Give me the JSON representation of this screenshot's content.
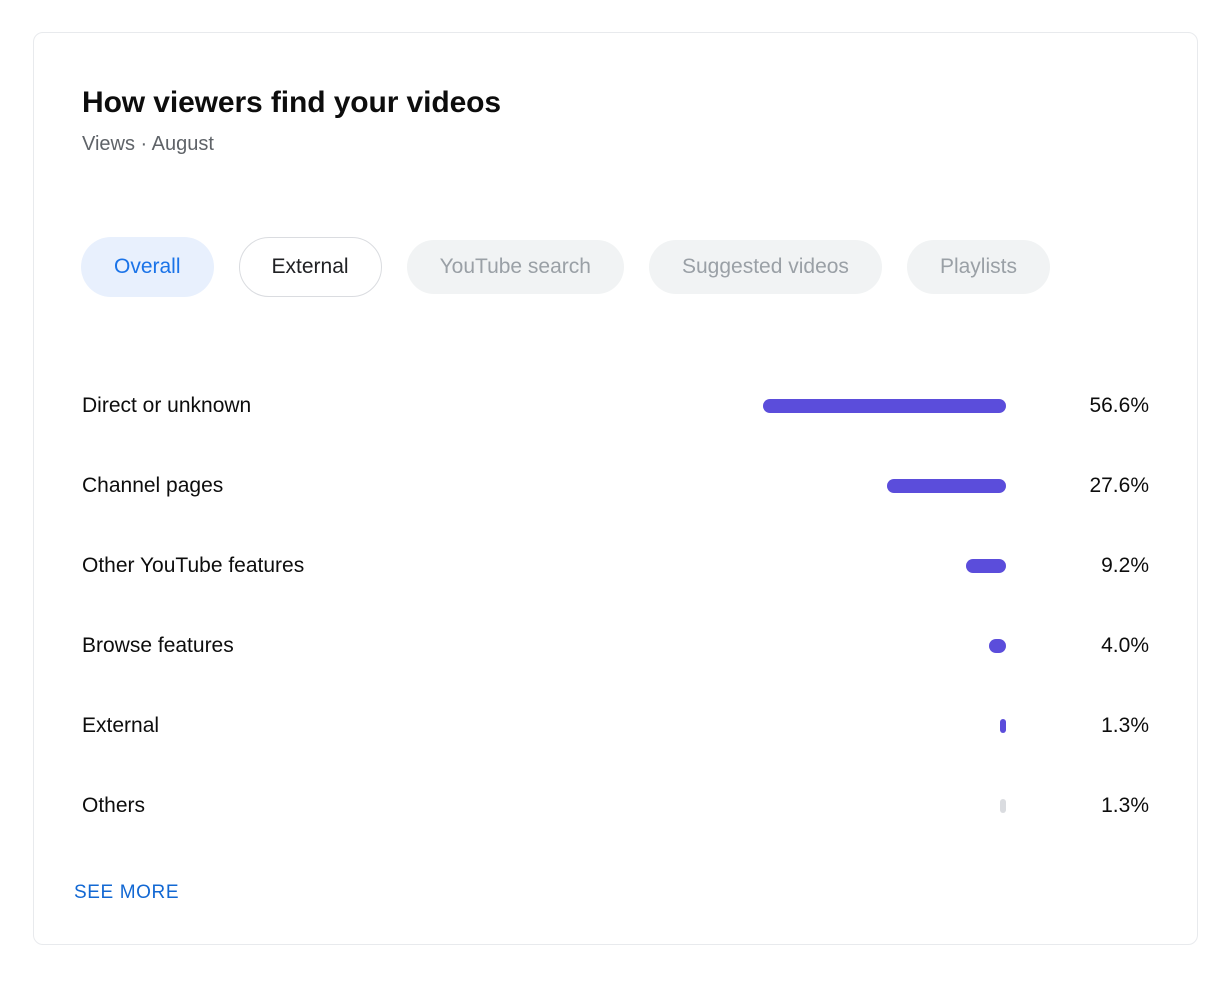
{
  "card": {
    "title": "How viewers find your videos",
    "subtitle": "Views · August",
    "see_more_label": "SEE MORE"
  },
  "chips": [
    {
      "label": "Overall",
      "state": "selected"
    },
    {
      "label": "External",
      "state": "outlined"
    },
    {
      "label": "YouTube search",
      "state": "muted"
    },
    {
      "label": "Suggested videos",
      "state": "muted"
    },
    {
      "label": "Playlists",
      "state": "muted"
    }
  ],
  "colors": {
    "bar_primary": "#5b4ddb",
    "bar_muted": "#dadce0",
    "accent_blue": "#1a73e8",
    "link_blue": "#1268d3",
    "chip_selected_bg": "#e8f0fd",
    "chip_muted_bg": "#f1f3f4",
    "card_border": "#e8eaed"
  },
  "chart_data": {
    "type": "bar",
    "title": "How viewers find your videos",
    "subtitle": "Views · August",
    "metric": "Views",
    "period": "August",
    "orientation": "horizontal",
    "bars_aligned": "right",
    "xlabel": "",
    "ylabel": "",
    "xlim": [
      0,
      100
    ],
    "grid": false,
    "legend": false,
    "unit": "%",
    "categories": [
      "Direct or unknown",
      "Channel pages",
      "Other YouTube features",
      "Browse features",
      "External",
      "Others"
    ],
    "values": [
      56.6,
      27.6,
      9.2,
      4.0,
      1.3,
      1.3
    ],
    "value_labels": [
      "56.6%",
      "27.6%",
      "9.2%",
      "4.0%",
      "1.3%",
      "1.3%"
    ],
    "bar_colors": [
      "#5b4ddb",
      "#5b4ddb",
      "#5b4ddb",
      "#5b4ddb",
      "#5b4ddb",
      "#dadce0"
    ]
  }
}
